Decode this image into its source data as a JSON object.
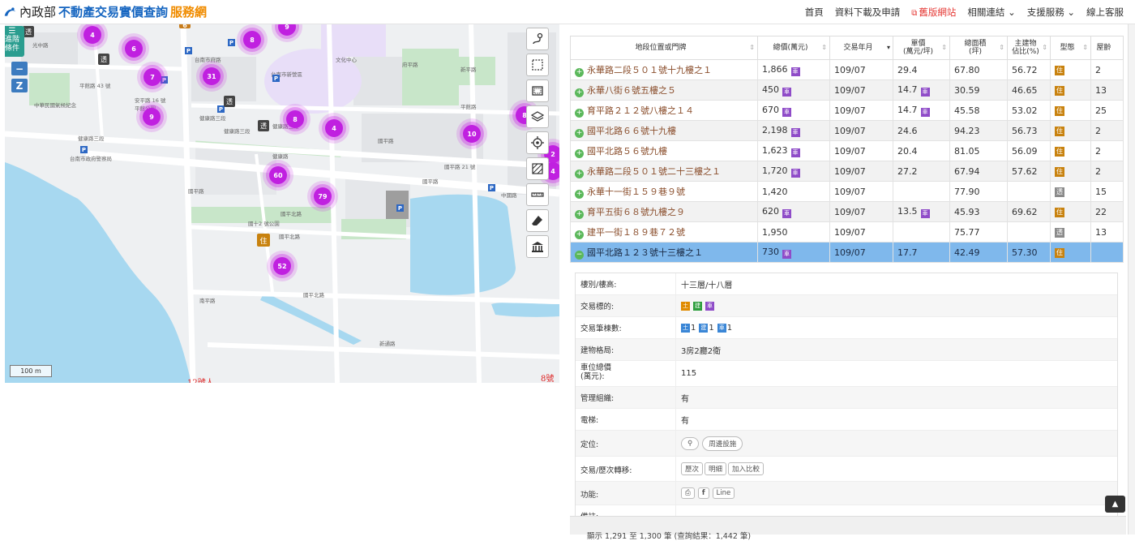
{
  "header": {
    "org": "內政部",
    "title": "不動產交易實價查詢",
    "suffix": "服務網",
    "nav": {
      "home": "首頁",
      "download": "資料下載及申請",
      "old_site": "舊版網站",
      "links": "相關連結",
      "support": "支援服務",
      "online": "線上客服"
    }
  },
  "map": {
    "filter_label_1": "進階",
    "filter_label_2": "條件",
    "zoom_out": "−",
    "zoom_mark": "Z",
    "scale": "100 m",
    "home_icon_glyph": "住",
    "tou_glyph": "透",
    "p_glyph": "P",
    "clusters": [
      "4",
      "6",
      "9",
      "8",
      "6",
      "7",
      "31",
      "8",
      "9",
      "8",
      "4",
      "10",
      "60",
      "79",
      "52",
      "2",
      "4"
    ],
    "labels": {
      "l1": "中華民國氣候紀念",
      "l2": "光中路",
      "l3": "平館路 43 號",
      "l4": "安平路 16 號",
      "l5": "平館公園",
      "l6": "健康路三段",
      "l7": "台南市政府警察局",
      "l8": "健康路三段",
      "l9": "國平北路",
      "l10": "國平北路",
      "l11": "健康路",
      "l12": "台南市新營區",
      "l13": "健康路三段",
      "l14": "文化中心",
      "l15": "府平路",
      "l16": "新平路",
      "l17": "國平路",
      "l18": "國平路 21 號",
      "l19": "平館路",
      "l20": "國平路",
      "l21": "中國路",
      "l22": "國十2 號公園",
      "l23": "國平北路",
      "l24": "國平路",
      "l25": "新通路",
      "l26": "南平路",
      "l27": "健康路三段",
      "l28": "台南市府路"
    },
    "red_text_1": "12號人",
    "red_text_2": "8號"
  },
  "table": {
    "headers": [
      "地段位置或門牌",
      "總價(萬元)",
      "交易年月",
      "單價\n(萬元/坪)",
      "總面積\n(坪)",
      "主建物\n佔比(%)",
      "型態",
      "屋齡"
    ],
    "car_glyph": "車",
    "rows": [
      {
        "addr": "永華路二段５０１號十九樓之１",
        "total": "1,866",
        "car": true,
        "date": "109/07",
        "unit": "29.4",
        "unit_car": false,
        "area": "67.80",
        "ratio": "56.72",
        "type": "住",
        "type_gray": false,
        "age": "2"
      },
      {
        "addr": "永華八街６號五樓之５",
        "total": "450",
        "car": true,
        "date": "109/07",
        "unit": "14.7",
        "unit_car": true,
        "area": "30.59",
        "ratio": "46.65",
        "type": "住",
        "type_gray": false,
        "age": "13"
      },
      {
        "addr": "育平路２１２號八樓之１４",
        "total": "670",
        "car": true,
        "date": "109/07",
        "unit": "14.7",
        "unit_car": true,
        "area": "45.58",
        "ratio": "53.02",
        "type": "住",
        "type_gray": false,
        "age": "25"
      },
      {
        "addr": "國平北路６６號十九樓",
        "total": "2,198",
        "car": true,
        "date": "109/07",
        "unit": "24.6",
        "unit_car": false,
        "area": "94.23",
        "ratio": "56.73",
        "type": "住",
        "type_gray": false,
        "age": "2"
      },
      {
        "addr": "國平北路５６號九樓",
        "total": "1,623",
        "car": true,
        "date": "109/07",
        "unit": "20.4",
        "unit_car": false,
        "area": "81.05",
        "ratio": "56.09",
        "type": "住",
        "type_gray": false,
        "age": "2"
      },
      {
        "addr": "永華路二段５０１號二十三樓之１",
        "total": "1,720",
        "car": true,
        "date": "109/07",
        "unit": "27.2",
        "unit_car": false,
        "area": "67.94",
        "ratio": "57.62",
        "type": "住",
        "type_gray": false,
        "age": "2"
      },
      {
        "addr": "永華十一街１５９巷９號",
        "total": "1,420",
        "car": false,
        "date": "109/07",
        "unit": "",
        "unit_car": false,
        "area": "77.90",
        "ratio": "",
        "type": "透",
        "type_gray": true,
        "age": "15"
      },
      {
        "addr": "育平五街６８號九樓之９",
        "total": "620",
        "car": true,
        "date": "109/07",
        "unit": "13.5",
        "unit_car": true,
        "area": "45.93",
        "ratio": "69.62",
        "type": "住",
        "type_gray": false,
        "age": "22"
      },
      {
        "addr": "建平一街１８９巷７２號",
        "total": "1,950",
        "car": false,
        "date": "109/07",
        "unit": "",
        "unit_car": false,
        "area": "75.77",
        "ratio": "",
        "type": "透",
        "type_gray": true,
        "age": "13"
      },
      {
        "addr": "國平北路１２３號十三樓之１",
        "total": "730",
        "car": true,
        "date": "109/07",
        "unit": "17.7",
        "unit_car": false,
        "area": "42.49",
        "ratio": "57.30",
        "type": "住",
        "type_gray": false,
        "age": "",
        "selected": true
      }
    ]
  },
  "detail": {
    "floor_k": "樓別/樓高:",
    "floor_v": "十三層/十八層",
    "target_k": "交易標的:",
    "target_b1": "土",
    "target_b2": "建",
    "target_b3": "車",
    "count_k": "交易筆棟數:",
    "count_b1": "土",
    "count_v1": "1",
    "count_b2": "建",
    "count_v2": "1",
    "count_b3": "車",
    "count_v3": "1",
    "layout_k": "建物格局:",
    "layout_v": "3房2廳2衛",
    "park_k1": "車位總價",
    "park_k2": "(萬元):",
    "park_v": "115",
    "mgmt_k": "管理組織:",
    "mgmt_v": "有",
    "elev_k": "電梯:",
    "elev_v": "有",
    "loc_k": "定位:",
    "loc_btn": "周邊設施",
    "hist_k": "交易/歷次轉移:",
    "hist_b1": "歷次",
    "hist_b2": "明細",
    "hist_b3": "加入比較",
    "func_k": "功能:",
    "func_line": "Line",
    "note_k": "備註:"
  },
  "footer": {
    "text": "顯示 1,291 至 1,300 筆 (查詢結果：1,442 筆)"
  }
}
